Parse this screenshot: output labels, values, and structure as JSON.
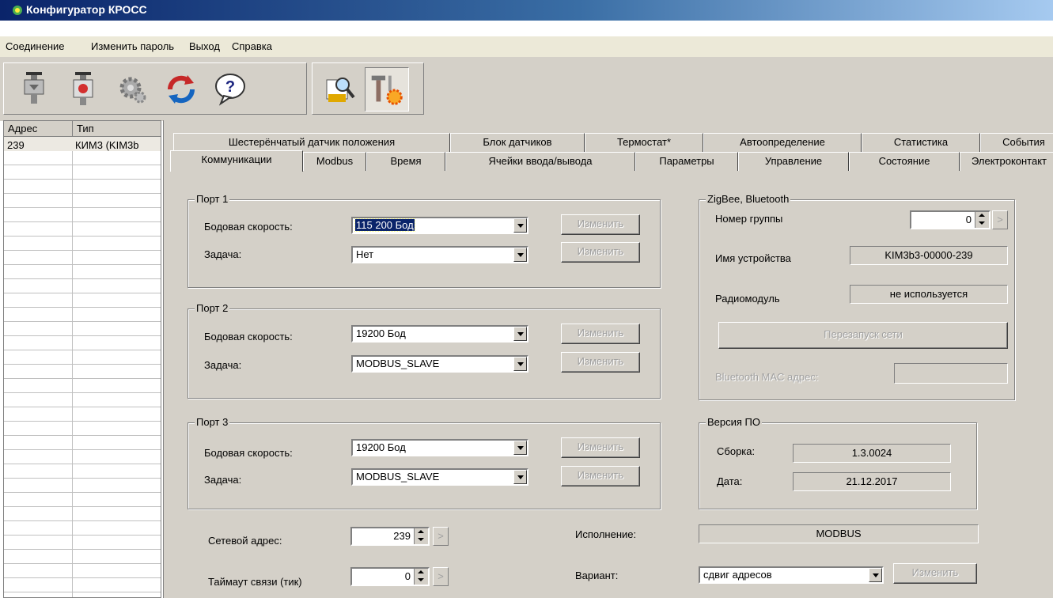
{
  "window": {
    "title": "Конфигуратор КРОСС"
  },
  "menu": [
    "Соединение",
    "Изменить пароль",
    "Выход",
    "Справка"
  ],
  "toolbar": {
    "buttons": [
      "connect-icon",
      "disconnect-icon",
      "settings-gear-icon",
      "refresh-icon",
      "help-icon",
      "search-device-icon",
      "tools-icon"
    ]
  },
  "device_list": {
    "columns": [
      "Адрес",
      "Тип"
    ],
    "rows": [
      {
        "address": "239",
        "type": "КИМ3 (KIM3b"
      }
    ]
  },
  "tabs": {
    "row1": [
      "Шестерёнчатый датчик положения",
      "Блок датчиков",
      "Термостат*",
      "Автоопределение",
      "Статистика",
      "События"
    ],
    "row2": [
      "Коммуникации",
      "Modbus",
      "Время",
      "Ячейки ввода/вывода",
      "Параметры",
      "Управление",
      "Состояние",
      "Электроконтакт"
    ],
    "active": "Коммуникации"
  },
  "ports": [
    {
      "title": "Порт 1",
      "baud_label": "Бодовая скорость:",
      "baud": "115 200 Бод",
      "task_label": "Задача:",
      "task": "Нет",
      "change": "Изменить"
    },
    {
      "title": "Порт 2",
      "baud_label": "Бодовая скорость:",
      "baud": "19200 Бод",
      "task_label": "Задача:",
      "task": "MODBUS_SLAVE",
      "change": "Изменить"
    },
    {
      "title": "Порт 3",
      "baud_label": "Бодовая скорость:",
      "baud": "19200 Бод",
      "task_label": "Задача:",
      "task": "MODBUS_SLAVE",
      "change": "Изменить"
    }
  ],
  "zigbee": {
    "title": "ZigBee, Bluetooth",
    "group_label": "Номер группы",
    "group_value": "0",
    "device_name_label": "Имя устройства",
    "device_name": "KIM3b3-00000-239",
    "radio_label": "Радиомодуль",
    "radio_value": "не используется",
    "restart_button": "Перезапуск сети",
    "mac_label": "Bluetooth MAC адрес:",
    "mac_value": ""
  },
  "firmware": {
    "title": "Версия ПО",
    "build_label": "Сборка:",
    "build": "1.3.0024",
    "date_label": "Дата:",
    "date": "21.12.2017"
  },
  "network": {
    "address_label": "Сетевой адрес:",
    "address": "239",
    "timeout_label": "Таймаут связи (тик)",
    "timeout": "0",
    "arrow": ">"
  },
  "execution": {
    "label": "Исполнение:",
    "value": "MODBUS"
  },
  "variant": {
    "label": "Вариант:",
    "value": "сдвиг адресов",
    "change": "Изменить"
  }
}
